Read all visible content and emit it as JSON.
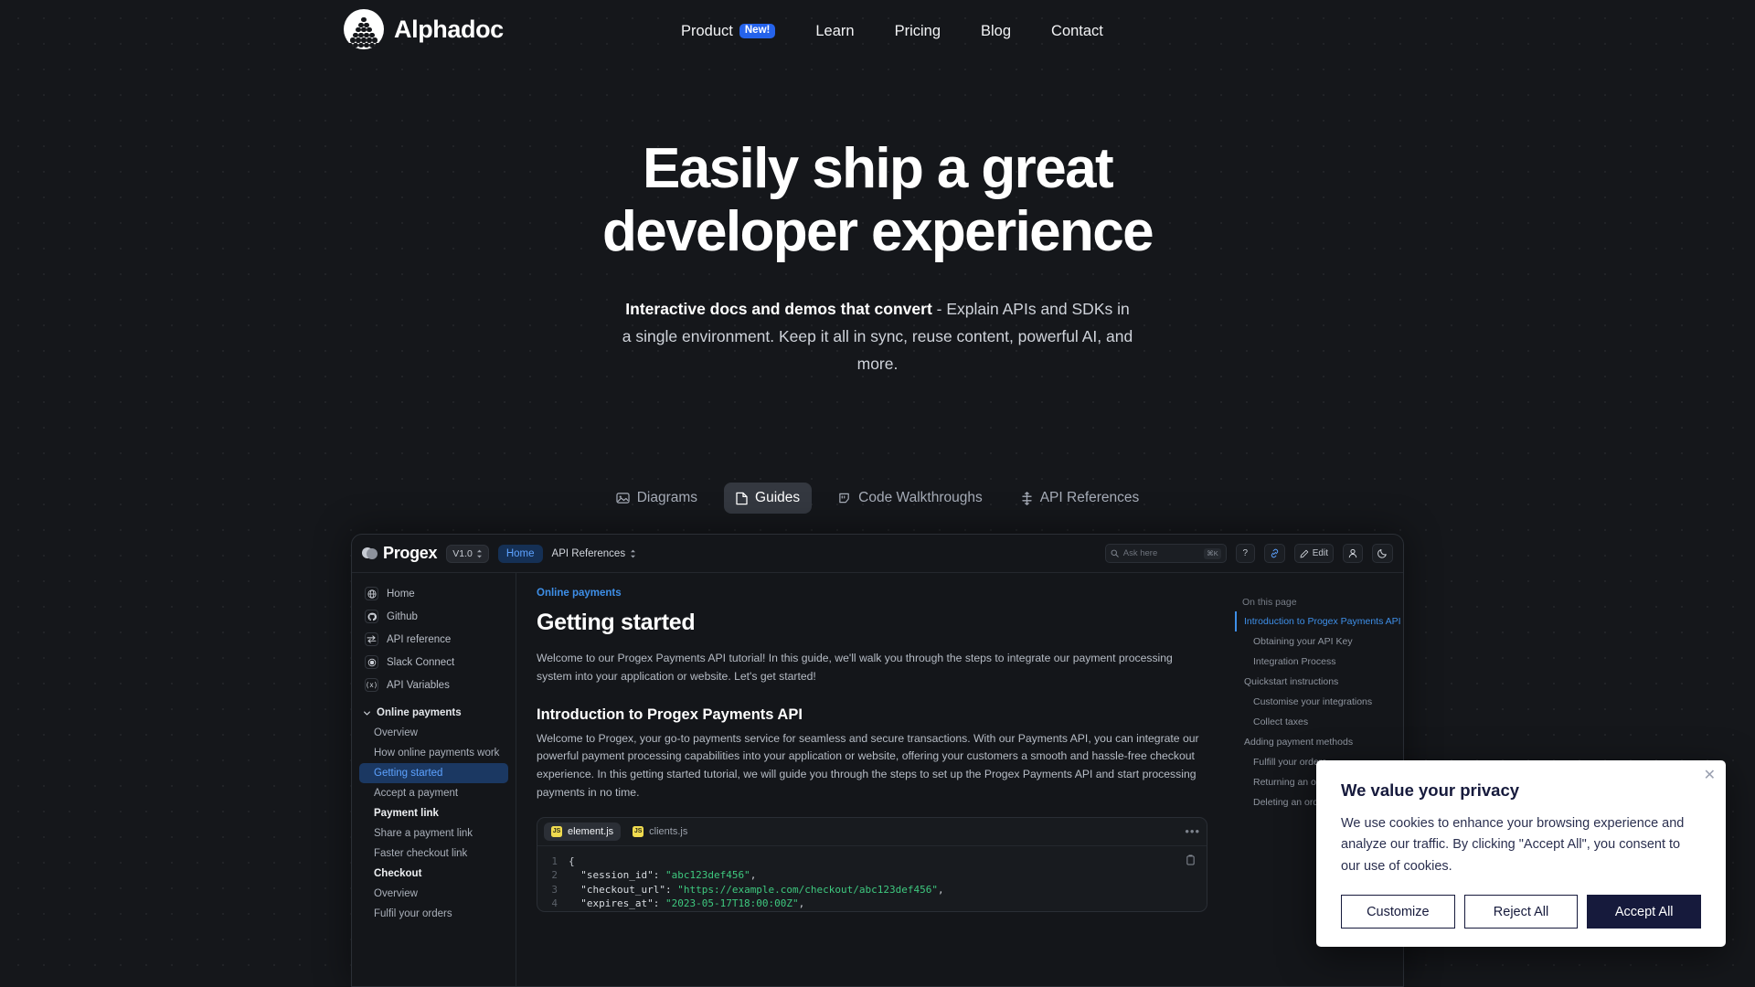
{
  "site": {
    "brand_name": "Alphadoc",
    "nav": [
      {
        "label": "Product",
        "badge": "New!"
      },
      {
        "label": "Learn",
        "badge": ""
      },
      {
        "label": "Pricing",
        "badge": ""
      },
      {
        "label": "Blog",
        "badge": ""
      },
      {
        "label": "Contact",
        "badge": ""
      }
    ],
    "accent_blue": "#2563eb"
  },
  "hero": {
    "line1": "Easily ship a great",
    "line2": "developer experience",
    "sub_bold": "Interactive docs and demos that convert",
    "sub_rest": " - Explain APIs and SDKs in a single environment. Keep it all in sync, reuse content, powerful AI, and more."
  },
  "tabs": [
    {
      "label": "Diagrams",
      "icon": "image-icon",
      "active": false
    },
    {
      "label": "Guides",
      "icon": "document-icon",
      "active": true
    },
    {
      "label": "Code Walkthroughs",
      "icon": "code-icon",
      "active": false
    },
    {
      "label": "API References",
      "icon": "api-icon",
      "active": false
    }
  ],
  "app": {
    "product_name": "Progex",
    "version_label": "V1.0",
    "home_label": "Home",
    "api_ref_label": "API References",
    "search_placeholder": "Ask here",
    "search_kbd": "⌘K",
    "help_label": "?",
    "edit_label": "Edit",
    "sidebar": {
      "links": [
        {
          "label": "Home",
          "icon": "globe-icon"
        },
        {
          "label": "Github",
          "icon": "github-icon"
        },
        {
          "label": "API reference",
          "icon": "arrows-icon"
        },
        {
          "label": "Slack Connect",
          "icon": "slack-icon"
        },
        {
          "label": "API Variables",
          "icon": "variable-icon"
        }
      ],
      "group_label": "Online payments",
      "items": [
        {
          "label": "Overview",
          "style": "normal"
        },
        {
          "label": "How online payments work",
          "style": "normal"
        },
        {
          "label": "Getting started",
          "style": "active"
        },
        {
          "label": "Accept a payment",
          "style": "normal"
        },
        {
          "label": "Payment link",
          "style": "bold"
        },
        {
          "label": "Share a payment link",
          "style": "normal"
        },
        {
          "label": "Faster checkout link",
          "style": "normal"
        },
        {
          "label": "Checkout",
          "style": "bold"
        },
        {
          "label": "Overview",
          "style": "normal"
        },
        {
          "label": "Fulfil your orders",
          "style": "normal"
        }
      ]
    },
    "content": {
      "breadcrumb": "Online payments",
      "title": "Getting started",
      "lead": "Welcome to our Progex Payments API tutorial! In this guide, we'll walk you through the steps to integrate our payment processing system into your application or website. Let's get started!",
      "section_title": "Introduction to Progex Payments API",
      "section_body": "Welcome to Progex, your go-to payments service for seamless and secure transactions. With our Payments API, you can integrate our powerful payment processing capabilities into your application or website, offering your customers a smooth and hassle-free checkout experience. In this getting started tutorial, we will guide you through the steps to set up the Progex Payments API and start processing payments in no time."
    },
    "code": {
      "tabs": [
        {
          "label": "element.js",
          "active": true
        },
        {
          "label": "clients.js",
          "active": false
        }
      ],
      "menu_glyph": "•••",
      "lines": [
        {
          "n": "1",
          "key": "",
          "value": "{",
          "tail": ""
        },
        {
          "n": "2",
          "key": "  \"session_id\": ",
          "value": "\"abc123def456\"",
          "tail": ","
        },
        {
          "n": "3",
          "key": "  \"checkout_url\": ",
          "value": "\"https://example.com/checkout/abc123def456\"",
          "tail": ","
        },
        {
          "n": "4",
          "key": "  \"expires_at\": ",
          "value": "\"2023-05-17T18:00:00Z\"",
          "tail": ","
        }
      ]
    },
    "toc": {
      "heading": "On this page",
      "items": [
        {
          "label": "Introduction to Progex Payments API",
          "sub": false,
          "active": true
        },
        {
          "label": "Obtaining your API Key",
          "sub": true,
          "active": false
        },
        {
          "label": "Integration Process",
          "sub": true,
          "active": false
        },
        {
          "label": "Quickstart instructions",
          "sub": false,
          "active": false
        },
        {
          "label": "Customise your integrations",
          "sub": true,
          "active": false
        },
        {
          "label": "Collect taxes",
          "sub": true,
          "active": false
        },
        {
          "label": "Adding payment methods",
          "sub": false,
          "active": false
        },
        {
          "label": "Fulfill your orders",
          "sub": true,
          "active": false
        },
        {
          "label": "Returning an order",
          "sub": true,
          "active": false
        },
        {
          "label": "Deleting an order",
          "sub": true,
          "active": false
        }
      ]
    }
  },
  "cookie": {
    "title": "We value your privacy",
    "body": "We use cookies to enhance your browsing experience and analyze our traffic. By clicking \"Accept All\", you consent to our use of cookies.",
    "customize": "Customize",
    "reject": "Reject All",
    "accept": "Accept All",
    "close_glyph": "✕",
    "primary_color": "#161a3c"
  }
}
